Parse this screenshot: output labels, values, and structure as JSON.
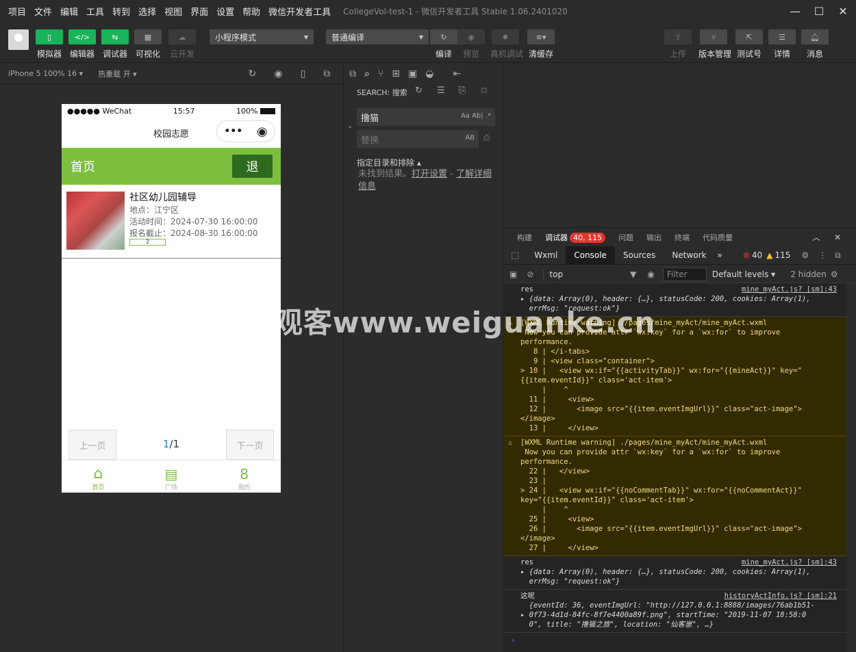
{
  "menu": [
    "项目",
    "文件",
    "编辑",
    "工具",
    "转到",
    "选择",
    "视图",
    "界面",
    "设置",
    "帮助",
    "微信开发者工具"
  ],
  "window_title": "CollegeVol-test-1 - 微信开发者工具 Stable 1.06.2401020",
  "toolbar": {
    "simulator": "模拟器",
    "editor": "编辑器",
    "debugger": "调试器",
    "visual": "可视化",
    "cloud": "云开发",
    "mode": "小程序模式",
    "compile_mode": "普通编译",
    "compile": "编译",
    "preview": "预览",
    "real_debug": "真机调试",
    "clear_cache": "清缓存",
    "upload": "上传",
    "version": "版本管理",
    "test": "测试号",
    "detail": "详情",
    "message": "消息"
  },
  "sim": {
    "device": "iPhone 5 100% 16 ▾",
    "hotreload": "热重载 开 ▾"
  },
  "phone": {
    "carrier": "●●●●● WeChat",
    "time": "15:57",
    "battery": "100%",
    "nav_title": "校园志愿",
    "header": "首页",
    "exit": "退",
    "card": {
      "title": "社区幼儿园辅导",
      "location": "地点：江宁区",
      "time": "活动时间：2024-07-30 16:00:00",
      "deadline": "报名截止：2024-08-30 16:00:00",
      "tag": "2"
    },
    "prev": "上一页",
    "next": "下一页",
    "page_cur": "1",
    "page_total": "/1",
    "tabs": [
      "首页",
      "广场",
      "我的"
    ]
  },
  "search": {
    "title": "SEARCH: 搜索",
    "query": "撸猫",
    "opts": "Aa Ab| .*",
    "replace_ph": "替换",
    "replace_opt": "AB",
    "include": "指定目录和排除 ▴",
    "msg": "未找到结果。",
    "open_settings": "打开设置",
    "sep": " - ",
    "learn_more": "了解详细信息"
  },
  "devtools": {
    "tabs": [
      "构建",
      "调试器",
      "问题",
      "输出",
      "终端",
      "代码质量"
    ],
    "badge": "40, 115",
    "panels": [
      "Wxml",
      "Console",
      "Sources",
      "Network",
      "»"
    ],
    "errors": "40",
    "warnings": "115",
    "context": "top",
    "filter_ph": "Filter",
    "levels": "Default levels ▾",
    "hidden": "2 hidden"
  },
  "console": [
    {
      "type": "log",
      "src": "mine_myAct.js? [sm]:43",
      "lines": [
        "res",
        "▸ {data: Array(0), header: {…}, statusCode: 200, cookies: Array(1),",
        "  errMsg: \"request:ok\"}"
      ]
    },
    {
      "type": "warn",
      "src": "",
      "lines": [
        "[WXML Runtime warning] ./pages/mine_myAct/mine_myAct.wxml",
        " Now you can provide attr `wx:key` for a `wx:for` to improve",
        "performance.",
        "   8 | </i-tabs>",
        "   9 | <view class=\"container\">",
        "> 10 |   <view wx:if=\"{{activityTab}}\" wx:for=\"{{mineAct}}\" key=\"",
        "{{item.eventId}}\" class='act-item'>",
        "     |    ^",
        "  11 |     <view>",
        "  12 |       <image src=\"{{item.eventImgUrl}}\" class=\"act-image\">",
        "</image>",
        "  13 |     </view>"
      ]
    },
    {
      "type": "warn",
      "src": "",
      "lines": [
        "[WXML Runtime warning] ./pages/mine_myAct/mine_myAct.wxml",
        " Now you can provide attr `wx:key` for a `wx:for` to improve",
        "performance.",
        "  22 |   </view>",
        "  23 |",
        "> 24 |   <view wx:if=\"{{noCommentTab}}\" wx:for=\"{{noCommentAct}}\"",
        "key=\"{{item.eventId}}\" class='act-item'>",
        "     |    ^",
        "  25 |     <view>",
        "  26 |       <image src=\"{{item.eventImgUrl}}\" class=\"act-image\">",
        "</image>",
        "  27 |     </view>"
      ]
    },
    {
      "type": "log",
      "src": "mine_myAct.js? [sm]:43",
      "lines": [
        "res",
        "▸ {data: Array(0), header: {…}, statusCode: 200, cookies: Array(1),",
        "  errMsg: \"request:ok\"}"
      ]
    },
    {
      "type": "log",
      "src": "historyActInfo.js? [sm]:21",
      "lines": [
        "这呢",
        "  {eventId: 36, eventImgUrl: \"http://127.0.0.1:8888/images/76ab1b51-",
        "▸ 0f73-4d1d-84fc-8f7e4400a89f.png\", startTime: \"2019-11-07 18:58:0",
        "  0\", title: \"撸猫之旅\", location: \"仙客崽\", …}"
      ]
    }
  ],
  "prompt": "›",
  "watermark": "cn围观客www.weiguanke.cn"
}
